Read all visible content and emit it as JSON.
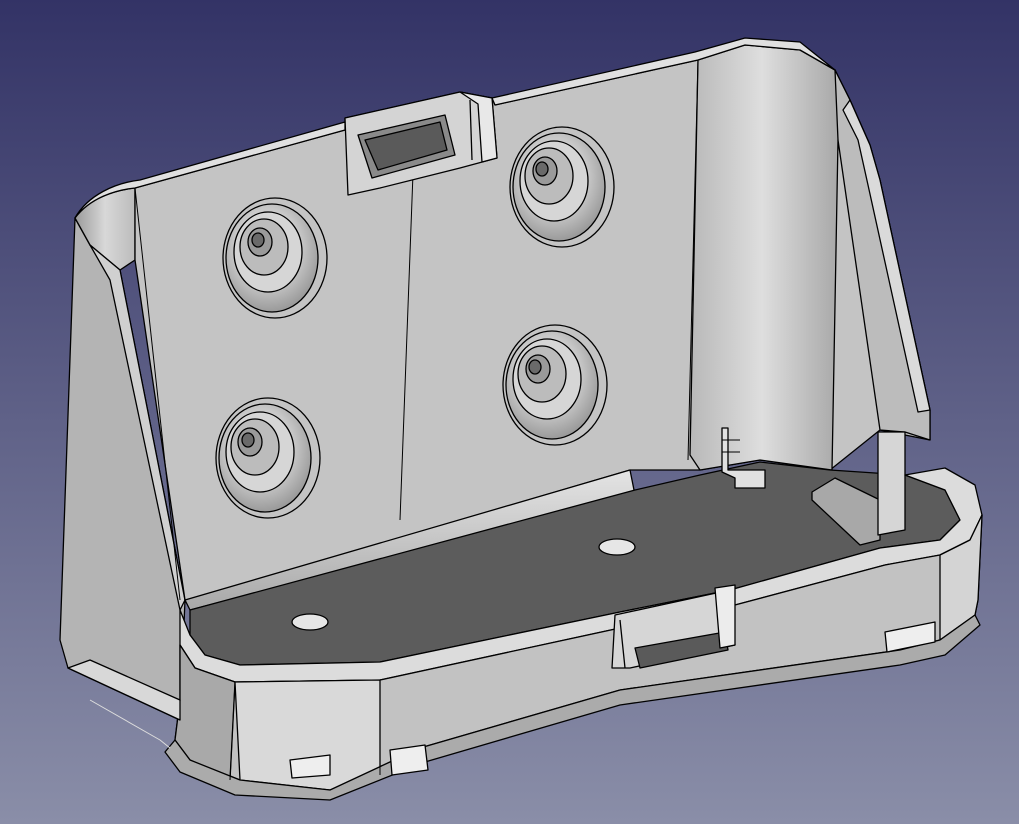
{
  "viewport": {
    "background_top": "#333366",
    "background_bottom": "#8a8ea8",
    "model_color": "#c8c8c8",
    "edge_color": "#000000"
  },
  "model": {
    "holes": 4,
    "tray_holes": 2,
    "slots": 2
  }
}
